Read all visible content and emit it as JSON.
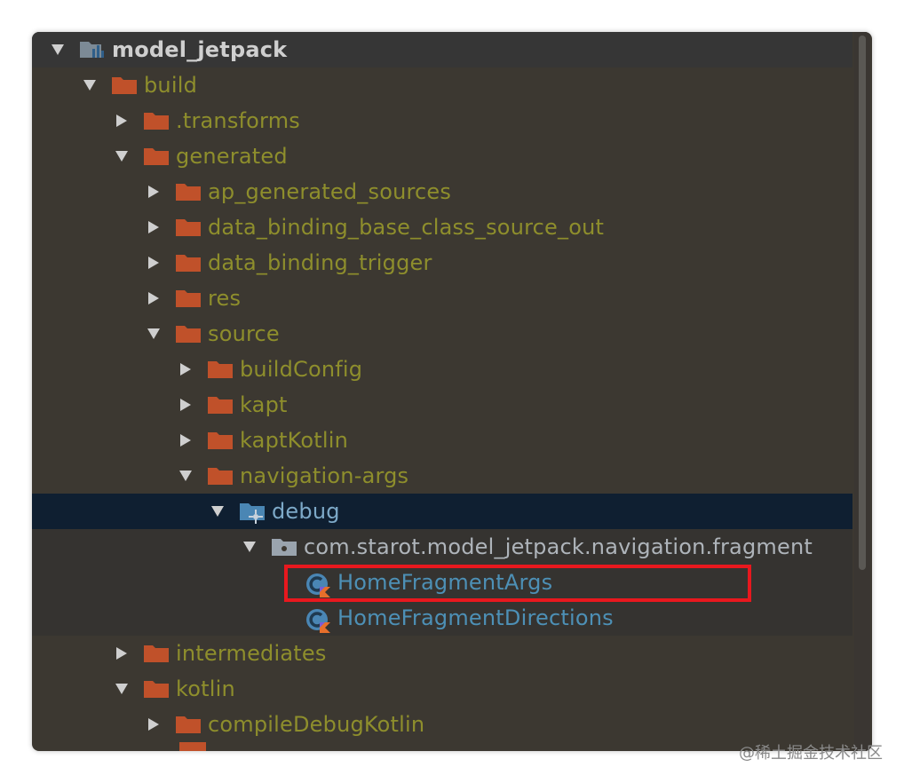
{
  "tree": {
    "root": {
      "label": "model_jetpack",
      "icon": "module-folder-icon",
      "expanded": true
    },
    "rows": [
      {
        "label": "build",
        "expanded": true,
        "icon": "folder-icon"
      },
      {
        "label": ".transforms",
        "expanded": false,
        "icon": "folder-icon"
      },
      {
        "label": "generated",
        "expanded": true,
        "icon": "folder-icon"
      },
      {
        "label": "ap_generated_sources",
        "expanded": false,
        "icon": "folder-icon"
      },
      {
        "label": "data_binding_base_class_source_out",
        "expanded": false,
        "icon": "folder-icon"
      },
      {
        "label": "data_binding_trigger",
        "expanded": false,
        "icon": "folder-icon"
      },
      {
        "label": "res",
        "expanded": false,
        "icon": "folder-icon"
      },
      {
        "label": "source",
        "expanded": true,
        "icon": "folder-icon"
      },
      {
        "label": "buildConfig",
        "expanded": false,
        "icon": "folder-icon"
      },
      {
        "label": "kapt",
        "expanded": false,
        "icon": "folder-icon"
      },
      {
        "label": "kaptKotlin",
        "expanded": false,
        "icon": "folder-icon"
      },
      {
        "label": "navigation-args",
        "expanded": true,
        "icon": "folder-icon"
      },
      {
        "label": "debug",
        "expanded": true,
        "icon": "source-root-folder-icon",
        "selected": true
      },
      {
        "label": "com.starot.model_jetpack.navigation.fragment",
        "expanded": true,
        "icon": "package-icon"
      },
      {
        "label": "HomeFragmentArgs",
        "icon": "kotlin-class-icon"
      },
      {
        "label": "HomeFragmentDirections",
        "icon": "kotlin-class-icon"
      },
      {
        "label": "intermediates",
        "expanded": false,
        "icon": "folder-icon"
      },
      {
        "label": "kotlin",
        "expanded": true,
        "icon": "folder-icon"
      },
      {
        "label": "compileDebugKotlin",
        "expanded": false,
        "icon": "folder-icon"
      }
    ]
  },
  "watermark": "@稀土掘金技术社区",
  "colors": {
    "panel_bg": "#3c3831",
    "selected_bg": "#0f1f31",
    "folder_label": "#8e8e2c",
    "folder_icon": "#c0512a",
    "class_label": "#4d90b6",
    "highlight_border": "#e8181e"
  }
}
